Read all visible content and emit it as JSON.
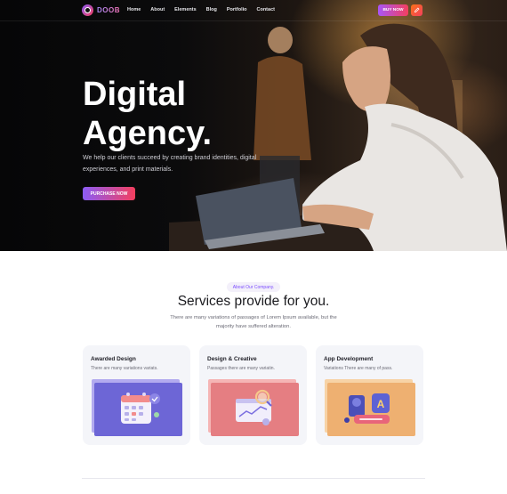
{
  "nav": {
    "brand": "DOOB",
    "items": [
      "Home",
      "About",
      "Elements",
      "Blog",
      "Portfolio",
      "Contact"
    ],
    "buy_label": "BUY NOW",
    "theme_icon": "pencil-icon"
  },
  "hero": {
    "title_line1": "Digital",
    "title_line2": "Agency.",
    "description": "We help our clients succeed by creating brand identities, digital experiences, and print materials.",
    "cta_label": "PURCHASE NOW"
  },
  "services": {
    "eyebrow": "About Our Company.",
    "title": "Services provide for you.",
    "description": "There are many variations of passages of Lorem Ipsum available, but the majority have suffered alteration.",
    "cards": [
      {
        "title": "Awarded Design",
        "text": "There are many variations variats.",
        "front_color": "#6d66d6",
        "back_color": "#b3abef",
        "icon": "calendar-icon"
      },
      {
        "title": "Design & Creative",
        "text": "Passages there are many variatin.",
        "front_color": "#e57e82",
        "back_color": "#f5b5b5",
        "icon": "browser-search-icon"
      },
      {
        "title": "App Development",
        "text": "Variations There are many of pass.",
        "front_color": "#eeb071",
        "back_color": "#f7d3a6",
        "icon": "app-typography-icon"
      }
    ]
  },
  "colors": {
    "accent_purple": "#8b5cf6",
    "accent_red": "#f43f5e"
  }
}
